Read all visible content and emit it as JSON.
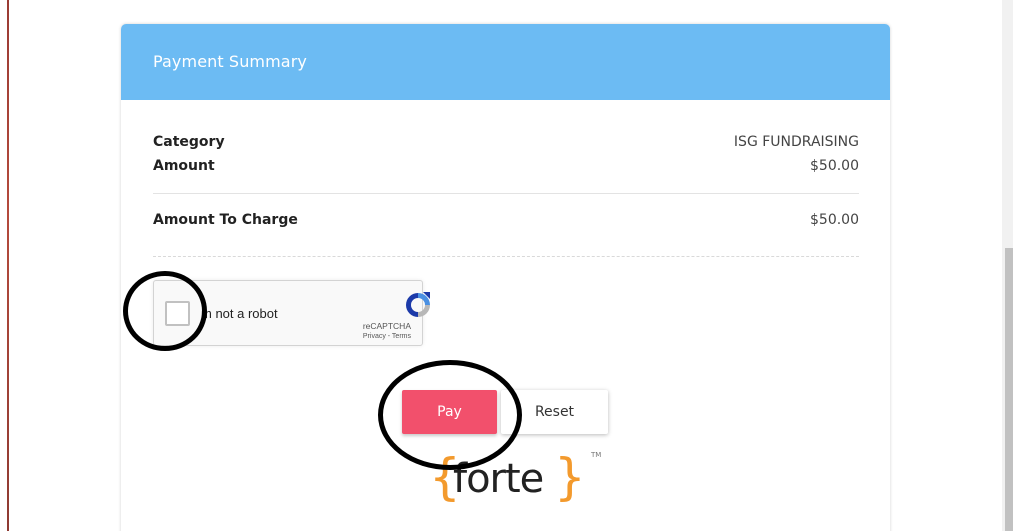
{
  "card": {
    "header_title": "Payment Summary"
  },
  "summary": {
    "category_label": "Category",
    "category_value": "ISG FUNDRAISING",
    "amount_label": "Amount",
    "amount_value": "$50.00",
    "charge_label": "Amount To Charge",
    "charge_value": "$50.00"
  },
  "recaptcha": {
    "label": "m not a robot",
    "brand": "reCAPTCHA",
    "terms": "Privacy - Terms"
  },
  "actions": {
    "pay_label": "Pay",
    "reset_label": "Reset"
  },
  "forte_logo": {
    "left_brace": "{",
    "word": "forte",
    "right_brace": "}",
    "tm": "TM"
  },
  "colors": {
    "header_bg": "#6cbbf3",
    "pay_bg": "#f2506c",
    "forte_accent": "#f39a2d"
  }
}
